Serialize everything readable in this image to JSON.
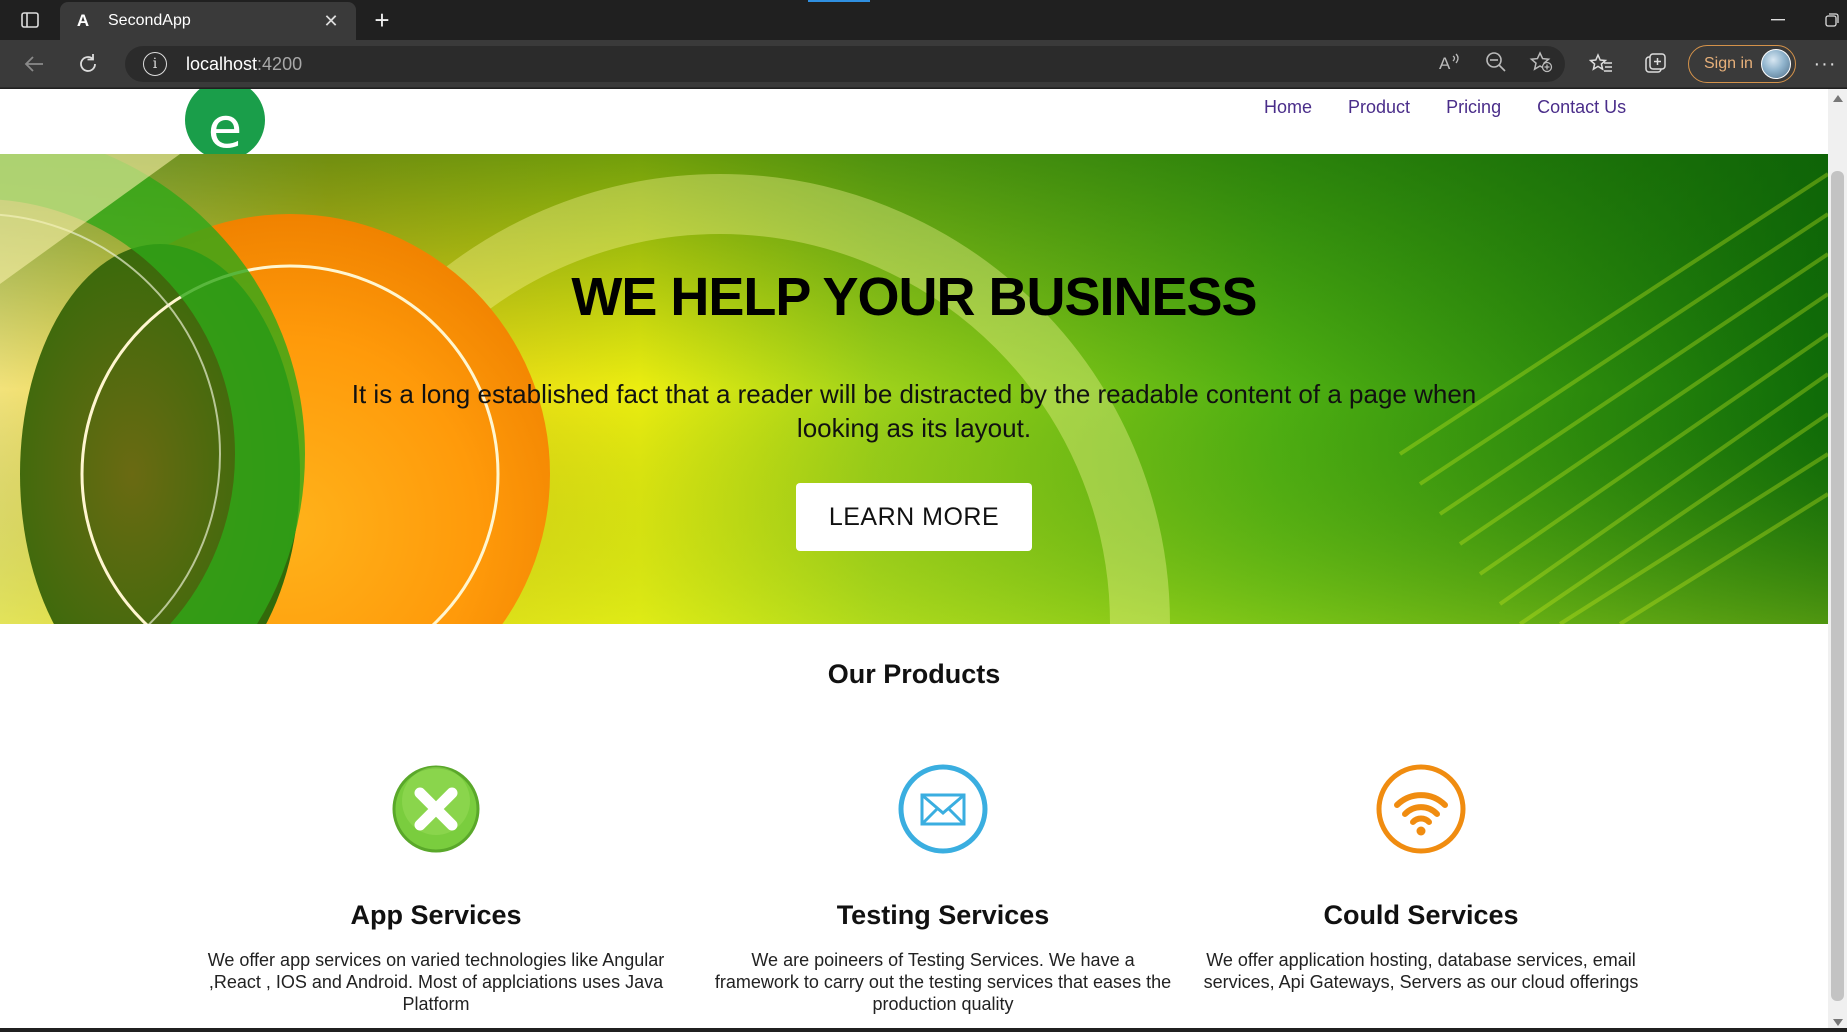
{
  "browser": {
    "tab_title": "SecondApp",
    "tab_favicon": "A",
    "address_host": "localhost",
    "address_port": ":4200",
    "sign_in_label": "Sign in"
  },
  "header": {
    "logo_letter": "e",
    "nav": [
      "Home",
      "Product",
      "Pricing",
      "Contact Us"
    ]
  },
  "hero": {
    "title": "WE HELP YOUR BUSINESS",
    "text": "It is a long established fact that a reader will be distracted by the readable content of a page when looking as its layout.",
    "button": "LEARN MORE"
  },
  "products": {
    "title": "Our Products",
    "items": [
      {
        "name": "App Services",
        "icon": "close-circle-icon",
        "color": "#6cc33a",
        "desc": "We offer app services on varied technologies like Angular ,React , IOS and Android. Most of applciations uses Java Platform"
      },
      {
        "name": "Testing Services",
        "icon": "envelope-icon",
        "color": "#3aaee0",
        "desc": "We are poineers of Testing Services. We have a framework to carry out the testing services that eases the production quality"
      },
      {
        "name": "Could Services",
        "icon": "wifi-icon",
        "color": "#f08c10",
        "desc": "We offer application hosting, database services, email services, Api Gateways, Servers as our cloud offerings"
      }
    ]
  },
  "colors": {
    "nav_link": "#4a2d8a",
    "brand_green": "#1a9e4a"
  }
}
